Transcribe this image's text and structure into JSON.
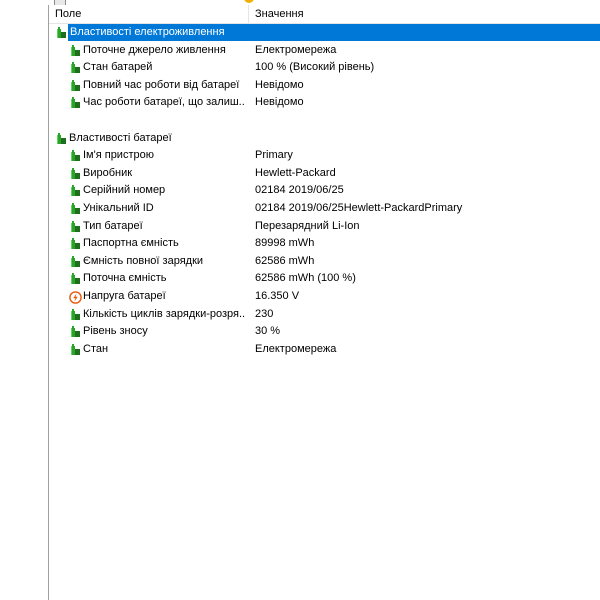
{
  "header": {
    "field": "Поле",
    "value": "Значення"
  },
  "colors": {
    "selection": "#0078d7",
    "battery_green": "#2aa52a",
    "battery_dark": "#1e6e1e",
    "warning_orange": "#e85a0c"
  },
  "groups": [
    {
      "label": "Властивості електроживлення",
      "icon": "battery-icon",
      "selected": true,
      "items": [
        {
          "label": "Поточне джерело живлення",
          "value": "Електромережа",
          "icon": "battery-icon"
        },
        {
          "label": "Стан батарей",
          "value": "100 % (Високий рівень)",
          "icon": "battery-icon"
        },
        {
          "label": "Повний час роботи від батареї",
          "value": "Невідомо",
          "icon": "battery-icon"
        },
        {
          "label": "Час роботи батареї, що залиш...",
          "value": "Невідомо",
          "icon": "battery-icon"
        }
      ]
    },
    {
      "label": "Властивості батареї",
      "icon": "battery-icon",
      "selected": false,
      "items": [
        {
          "label": "Ім'я пристрою",
          "value": "Primary",
          "icon": "battery-icon"
        },
        {
          "label": "Виробник",
          "value": "Hewlett-Packard",
          "icon": "battery-icon"
        },
        {
          "label": "Серійний номер",
          "value": "02184 2019/06/25",
          "icon": "battery-icon"
        },
        {
          "label": "Унікальний ID",
          "value": "02184 2019/06/25Hewlett-PackardPrimary",
          "icon": "battery-icon"
        },
        {
          "label": "Тип батареї",
          "value": "Перезарядний Li-Ion",
          "icon": "battery-icon"
        },
        {
          "label": "Паспортна ємність",
          "value": "89998 mWh",
          "icon": "battery-icon"
        },
        {
          "label": "Ємність повної зарядки",
          "value": "62586 mWh",
          "icon": "battery-icon"
        },
        {
          "label": "Поточна ємність",
          "value": "62586 mWh  (100 %)",
          "icon": "battery-icon"
        },
        {
          "label": "Напруга батареї",
          "value": "16.350 V",
          "icon": "voltage-icon"
        },
        {
          "label": "Кількість циклів зарядки-розря...",
          "value": "230",
          "icon": "battery-icon"
        },
        {
          "label": "Рівень зносу",
          "value": "30 %",
          "icon": "battery-icon"
        },
        {
          "label": "Стан",
          "value": "Електромережа",
          "icon": "battery-icon"
        }
      ]
    }
  ]
}
